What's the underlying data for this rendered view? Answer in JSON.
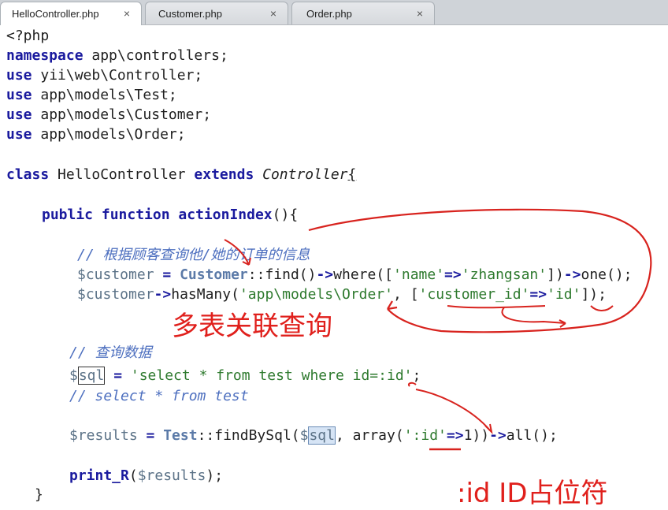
{
  "tabs": [
    {
      "label": "HelloController.php",
      "close": "×"
    },
    {
      "label": "Customer.php",
      "close": "×"
    },
    {
      "label": "Order.php",
      "close": "×"
    }
  ],
  "code": {
    "l1": "<?php",
    "l2_kw": "namespace",
    "l2_rest": " app\\controllers;",
    "use": "use",
    "l3_rest": " yii\\web\\Controller;",
    "l4_rest": " app\\models\\Test;",
    "l5_rest": " app\\models\\Customer;",
    "l6_rest": " app\\models\\Order;",
    "l8_class": "class",
    "l8_name": " HelloController ",
    "l8_extends": "extends",
    "l8_parent": " Controller",
    "l8_brace": "{",
    "l10_public": "public",
    "l10_function": "function",
    "l10_name": "actionIndex",
    "l10_rest": "(){",
    "l12_comment": "// 根据顾客查询他/她的订单的信息",
    "l13_var": "$customer",
    "l13_eq": " = ",
    "l13_cls": "Customer",
    "l13_a": "::find()",
    "l13_arrow1": "->",
    "l13_b": "where([",
    "l13_s1": "'name'",
    "l13_op": "=>",
    "l13_s2": "'zhangsan'",
    "l13_c": "])",
    "l13_arrow2": "->",
    "l13_d": "one();",
    "l14_var": "$customer",
    "l14_arrow": "->",
    "l14_a": "hasMany(",
    "l14_s1": "'app\\models\\Order'",
    "l14_b": ", [",
    "l14_s2": "'customer_id'",
    "l14_op": "=>",
    "l14_s3": "'id'",
    "l14_c": "]);",
    "l17_comment": "// 查询数据",
    "l18_dollar": "$",
    "l18_sql": "sql",
    "l18_eq": " = ",
    "l18_str": "'select * from test where id=:id'",
    "l18_end": ";",
    "l19_comment": "// select * from test",
    "l21_var": "$results",
    "l21_eq": " = ",
    "l21_cls": "Test",
    "l21_a": "::findBySql(",
    "l21_dollar": "$",
    "l21_sql": "sql",
    "l21_b": ", array(",
    "l21_s": "':id'",
    "l21_op": "=>",
    "l21_c": "1))",
    "l21_arrow": "->",
    "l21_d": "all();",
    "l23_fn": "print_R",
    "l23_a": "(",
    "l23_var": "$results",
    "l23_b": ");",
    "l24": "}"
  },
  "annotations": {
    "multi_table": "多表关联查询",
    "placeholder": ":id ID占位符"
  },
  "colors": {
    "annotation": "#e0201c",
    "keyword": "#1a1a9e",
    "string": "#2e7a2e",
    "comment": "#4d6fbf"
  }
}
